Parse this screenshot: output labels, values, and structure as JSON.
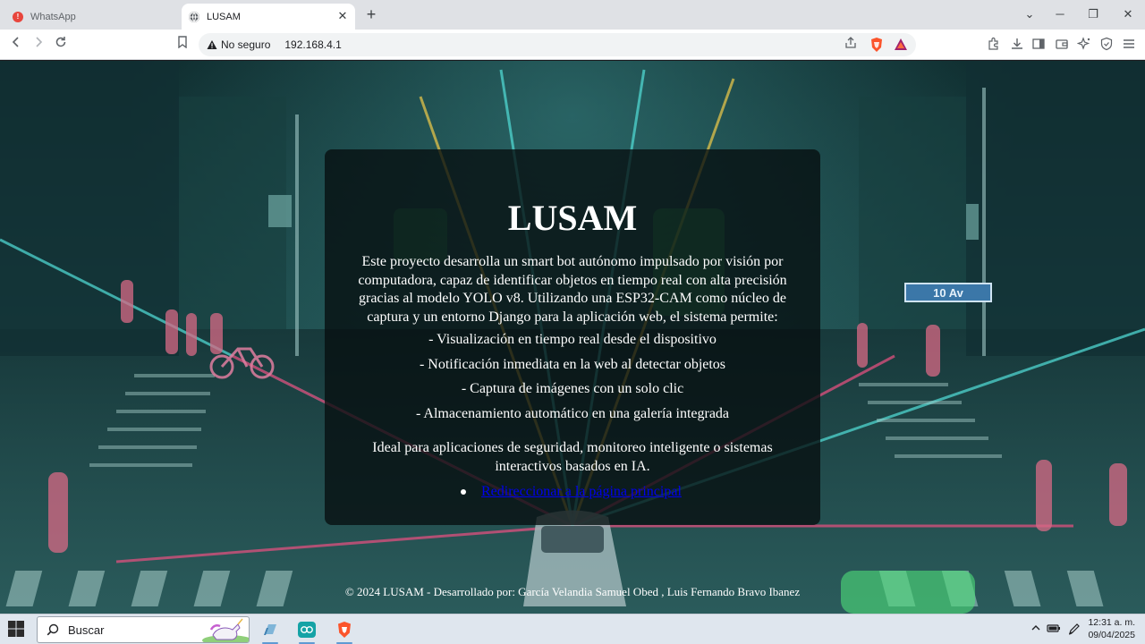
{
  "browser": {
    "tabs": [
      {
        "title": "WhatsApp",
        "favicon": "whatsapp-alert-icon",
        "active": false
      },
      {
        "title": "LUSAM",
        "favicon": "globe-icon",
        "active": true
      }
    ],
    "address_bar": {
      "security_label": "No seguro",
      "url": "192.168.4.1"
    }
  },
  "page": {
    "title": "LUSAM",
    "intro": "Este proyecto desarrolla un smart bot autónomo impulsado por visión por computadora, capaz de identificar objetos en tiempo real con alta precisión gracias al modelo YOLO v8. Utilizando una ESP32-CAM como núcleo de captura y un entorno Django para la aplicación web, el sistema permite:",
    "features": [
      "- Visualización en tiempo real desde el dispositivo",
      "- Notificación inmediata en la web al detectar objetos",
      "- Captura de imágenes con un solo clic",
      "- Almacenamiento automático en una galería integrada"
    ],
    "closing": "Ideal para aplicaciones de seguridad, monitoreo inteligente o sistemas interactivos basados en IA.",
    "link_text": "Redireccionar a la página principal",
    "footer": "© 2024 LUSAM - Desarrollado por: García Velandia Samuel Obed , Luis Fernando Bravo Ibanez",
    "background_sign": "10 Av"
  },
  "taskbar": {
    "search_placeholder": "Buscar",
    "clock_time": "12:31 a. m.",
    "clock_date": "09/04/2025"
  },
  "colors": {
    "card_background": "#060e10",
    "link": "#0000ee",
    "scene_teal": "#1d4a4b"
  }
}
